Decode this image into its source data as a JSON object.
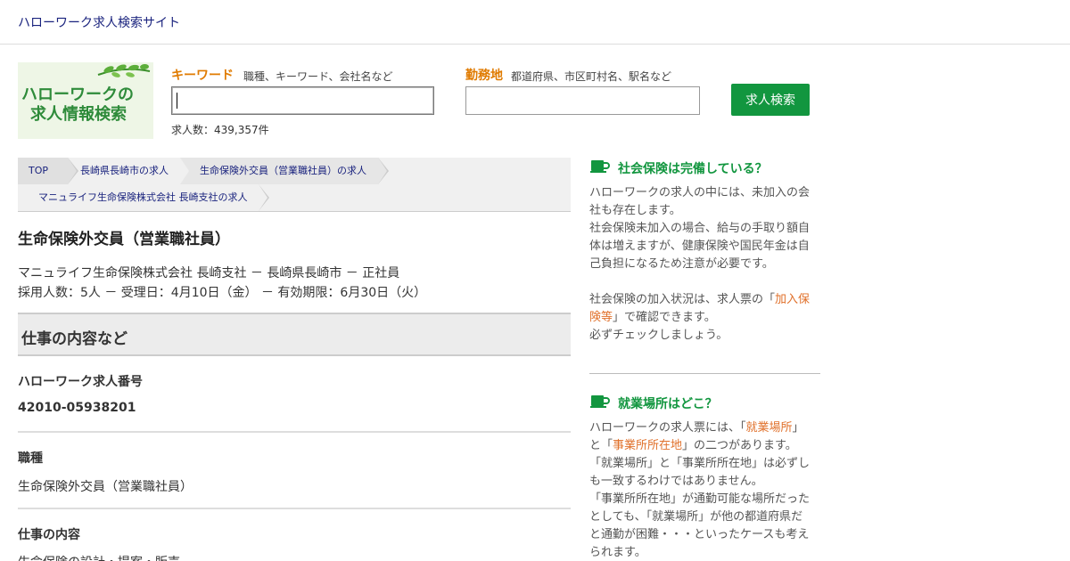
{
  "header": {
    "site_title": "ハローワーク求人検索サイト"
  },
  "logo": {
    "line1": "ハローワークの",
    "line2": "求人情報検索"
  },
  "search": {
    "keyword_label": "キーワード",
    "keyword_hint": "職種、キーワード、会社名など",
    "keyword_value": "",
    "location_label": "勤務地",
    "location_hint": "都道府県、市区町村名、駅名など",
    "location_value": "",
    "button_label": "求人検索",
    "count_text": "求人数：439,357件"
  },
  "breadcrumb": [
    "TOP",
    "長崎県長崎市の求人",
    "生命保険外交員（営業職社員）の求人",
    "マニュライフ生命保険株式会社 長崎支社の求人"
  ],
  "job": {
    "title": "生命保険外交員（営業職社員）",
    "meta_line1": "マニュライフ生命保険株式会社 長崎支社 － 長崎県長崎市 － 正社員",
    "meta_line2": "採用人数：5人 － 受理日：4月10日（金） － 有効期限：6月30日（火）",
    "section_title": "仕事の内容など",
    "fields": [
      {
        "label": "ハローワーク求人番号",
        "value": "42010-05938201"
      },
      {
        "label": "職種",
        "value": "生命保険外交員（営業職社員）"
      },
      {
        "label": "仕事の内容",
        "value": "生命保険の設計・提案・販売"
      }
    ]
  },
  "sidebar": {
    "box1": {
      "title": "社会保険は完備している？",
      "p1_l1": "ハローワークの求人の中には、未加入の会",
      "p1_l2": "社も存在します。",
      "p1_l3": "社会保険未加入の場合、給与の手取り額自",
      "p1_l4": "体は増えますが、健康保険や国民年金は自",
      "p1_l5": "己負担になるため注意が必要です。",
      "p2_a": "社会保険の加入状況は、求人票の「",
      "p2_hl1": "加入保",
      "p2_hl2": "険等",
      "p2_b": "」で確認できます。",
      "p2_c": "必ずチェックしましょう。"
    },
    "box2": {
      "title": "就業場所はどこ？",
      "l1a": "ハローワークの求人票には、「",
      "l1hl": "就業場所",
      "l1b": "」",
      "l2a": "と「",
      "l2hl": "事業所所在地",
      "l2b": "」の二つがあります。",
      "l3": "「就業場所」と「事業所所在地」は必ずし",
      "l4": "も一致するわけではありません。",
      "l5": "「事業所所在地」が通勤可能な場所だった",
      "l6": "としても、「就業場所」が他の都道府県だ",
      "l7": "と通勤が困難・・・といったケースも考え",
      "l8": "られます。"
    }
  },
  "colors": {
    "accent_green": "#12963f",
    "label_orange": "#e07b00",
    "link_navy": "#1a237e",
    "highlight": "#e0702a"
  }
}
